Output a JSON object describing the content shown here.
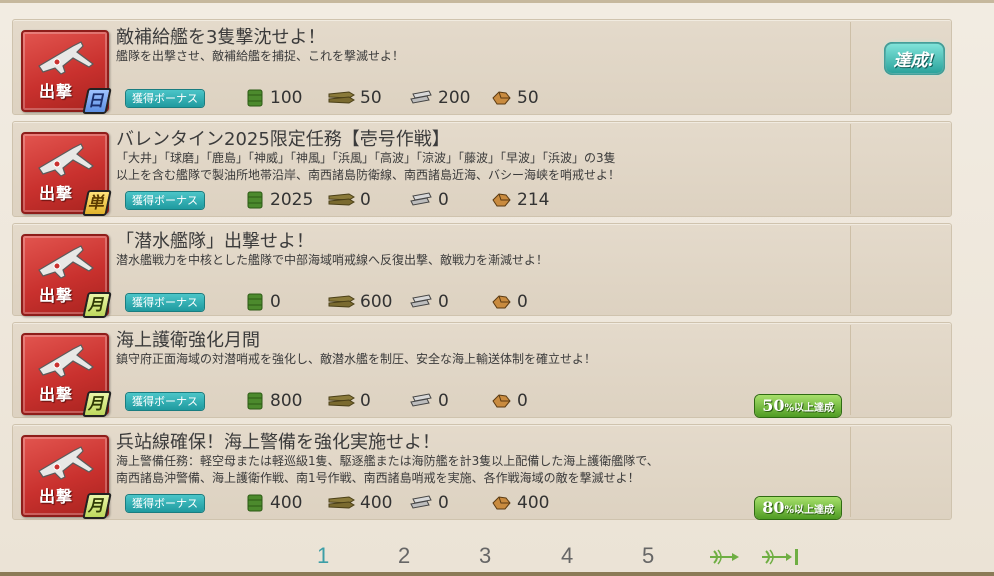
{
  "quests": [
    {
      "category": "出撃",
      "frequency": "日",
      "frequency_type": "daily",
      "title": "敵補給艦を3隻撃沈せよ！",
      "description": [
        "艦隊を出撃させ、敵補給艦を捕捉、これを撃滅せよ！"
      ],
      "bonus_label": "獲得ボーナス",
      "rewards": {
        "fuel": "100",
        "ammo": "50",
        "steel": "200",
        "bauxite": "50"
      },
      "status": "達成!",
      "progress": ""
    },
    {
      "category": "出撃",
      "frequency": "単",
      "frequency_type": "once",
      "title": "バレンタイン2025限定任務【壱号作戦】",
      "description": [
        "「大井」「球磨」「鹿島」「神威」「神風」「浜風」「高波」「涼波」「藤波」「早波」「浜波」の3隻",
        "以上を含む艦隊で製油所地帯沿岸、南西諸島防衛線、南西諸島近海、バシー海峡を哨戒せよ！"
      ],
      "bonus_label": "獲得ボーナス",
      "rewards": {
        "fuel": "2025",
        "ammo": "0",
        "steel": "0",
        "bauxite": "214"
      },
      "status": "",
      "progress": ""
    },
    {
      "category": "出撃",
      "frequency": "月",
      "frequency_type": "monthly",
      "title": "「潜水艦隊」出撃せよ！",
      "description": [
        "潜水艦戦力を中核とした艦隊で中部海域哨戒線へ反復出撃、敵戦力を漸減せよ！"
      ],
      "bonus_label": "獲得ボーナス",
      "rewards": {
        "fuel": "0",
        "ammo": "600",
        "steel": "0",
        "bauxite": "0"
      },
      "status": "",
      "progress": ""
    },
    {
      "category": "出撃",
      "frequency": "月",
      "frequency_type": "monthly",
      "title": "海上護衛強化月間",
      "description": [
        "鎮守府正面海域の対潜哨戒を強化し、敵潜水艦を制圧、安全な海上輸送体制を確立せよ！"
      ],
      "bonus_label": "獲得ボーナス",
      "rewards": {
        "fuel": "800",
        "ammo": "0",
        "steel": "0",
        "bauxite": "0"
      },
      "status": "",
      "progress": {
        "number": "50",
        "unit": "%以上達成"
      }
    },
    {
      "category": "出撃",
      "frequency": "月",
      "frequency_type": "monthly",
      "title": "兵站線確保！海上警備を強化実施せよ！",
      "description": [
        "海上警備任務：軽空母または軽巡級1隻、駆逐艦または海防艦を計3隻以上配備した海上護衛艦隊で、",
        "南西諸島沖警備、海上護衛作戦、南1号作戦、南西諸島哨戒を実施、各作戦海域の敵を撃滅せよ！"
      ],
      "bonus_label": "獲得ボーナス",
      "rewards": {
        "fuel": "400",
        "ammo": "400",
        "steel": "0",
        "bauxite": "400"
      },
      "status": "",
      "progress": {
        "number": "80",
        "unit": "%以上達成"
      }
    }
  ],
  "pagination": {
    "pages": [
      "1",
      "2",
      "3",
      "4",
      "5"
    ],
    "current": "1",
    "next_icon": "next-page-icon",
    "last_icon": "last-page-icon"
  },
  "colors": {
    "accent": "#3c9ea6",
    "category_red": "#c9312e",
    "bonus_teal": "#1f9a9f",
    "progress_green": "#4f9b23"
  }
}
